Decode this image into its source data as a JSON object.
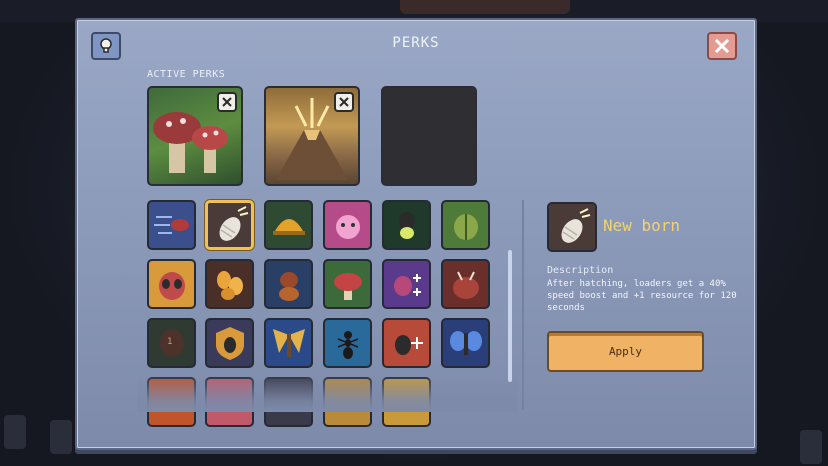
{
  "panel": {
    "title": "PERKS",
    "active_label": "ACTIVE PERKS"
  },
  "active_slots": [
    {
      "name": "mushroom-perk",
      "filled": true
    },
    {
      "name": "volcano-perk",
      "filled": true
    },
    {
      "name": "empty-slot",
      "filled": false
    }
  ],
  "grid_perks": [
    [
      "fast-ant",
      "new-born",
      "helmet",
      "pink-bug",
      "firefly",
      "beetle"
    ],
    [
      "queen-face",
      "larvae",
      "red-ant",
      "red-mushroom",
      "ant-plus",
      "red-ant-head"
    ],
    [
      "locked-1",
      "ant-shield",
      "moth",
      "ant-silhouette",
      "ant-plus-red",
      "blue-moth"
    ],
    [
      "red-perk",
      "pink-perk",
      "dark-perk",
      "gold-perk",
      "yellow-bug"
    ]
  ],
  "grid_labels": {
    "locked_number": "1"
  },
  "selected": {
    "name": "New born",
    "description_label": "Description",
    "description": "After hatching, loaders get a 40% speed boost and +1 resource for 120 seconds",
    "apply_label": "Apply"
  },
  "colors": {
    "accent_yellow": "#f4d36c",
    "apply": "#f0b265",
    "close": "#e39b92"
  }
}
